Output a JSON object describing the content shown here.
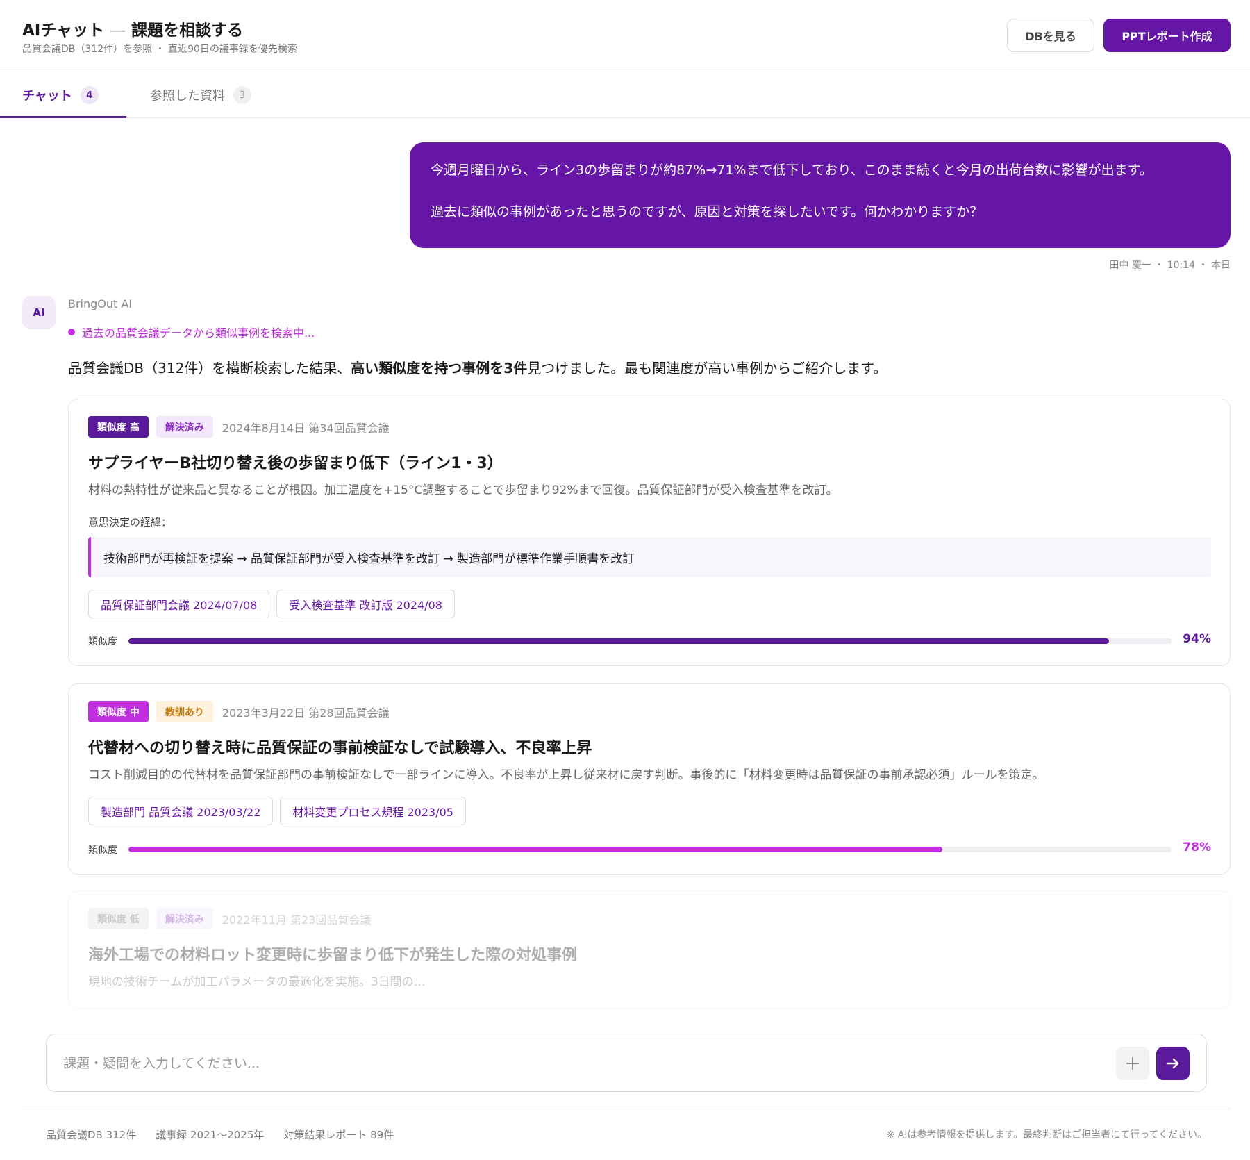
{
  "header": {
    "title": "AIチャット",
    "title_sep": "—",
    "title_sub": "課題を相談する",
    "subtitle": "品質会議DB（312件）を参照 ・ 直近90日の議事録を優先検索",
    "btn_db": "DBを見る",
    "btn_ppt": "PPTレポート作成"
  },
  "tabs": [
    {
      "label": "チャット",
      "count": "4",
      "active": true
    },
    {
      "label": "参照した資料",
      "count": "3",
      "active": false
    }
  ],
  "user_message": {
    "line1": "今週月曜日から、ライン3の歩留まりが約87%→71%まで低下しており、このまま続くと今月の出荷台数に影響が出ます。",
    "line2": "過去に類似の事例があったと思うのですが、原因と対策を探したいです。何かわかりますか？",
    "meta": "田中 慶一 ・ 10:14 ・ 本日"
  },
  "ai": {
    "avatar": "AI",
    "name": "BringOut AI",
    "status": "過去の品質会議データから類似事例を検索中...",
    "intro_pre": "品質会議DB（312件）を横断検索した結果、",
    "intro_bold": "高い類似度を持つ事例を3件",
    "intro_post": "見つけました。最も関連度が高い事例からご紹介します。"
  },
  "cases": [
    {
      "similarity_badge": "類似度 高",
      "status_badge": "解決済み",
      "date": "2024年8月14日 第34回品質会議",
      "title": "サプライヤーB社切り替え後の歩留まり低下（ライン1・3）",
      "desc": "材料の熱特性が従来品と異なることが根因。加工温度を+15°C調整することで歩留まり92%まで回復。品質保証部門が受入検査基準を改訂。",
      "decision_label": "意思決定の経緯：",
      "decision": "技術部門が再検証を提案 → 品質保証部門が受入検査基準を改訂 → 製造部門が標準作業手順書を改訂",
      "chips": [
        "品質保証部門会議 2024/07/08",
        "受入検査基準 改訂版 2024/08"
      ],
      "sim_label": "類似度",
      "sim_value": 94,
      "sim_text": "94%"
    },
    {
      "similarity_badge": "類似度 中",
      "status_badge": "教訓あり",
      "date": "2023年3月22日 第28回品質会議",
      "title": "代替材への切り替え時に品質保証の事前検証なしで試験導入、不良率上昇",
      "desc": "コスト削減目的の代替材を品質保証部門の事前検証なしで一部ラインに導入。不良率が上昇し従来材に戻す判断。事後的に「材料変更時は品質保証の事前承認必須」ルールを策定。",
      "chips": [
        "製造部門 品質会議 2023/03/22",
        "材料変更プロセス規程 2023/05"
      ],
      "sim_label": "類似度",
      "sim_value": 78,
      "sim_text": "78%"
    },
    {
      "similarity_badge": "類似度 低",
      "status_badge": "解決済み",
      "date": "2022年11月 第23回品質会議",
      "title": "海外工場での材料ロット変更時に歩留まり低下が発生した際の対処事例",
      "desc": "現地の技術チームが加工パラメータの最適化を実施。3日間の…"
    }
  ],
  "input": {
    "placeholder": "課題・疑問を入力してください..."
  },
  "footer": {
    "stat1": "品質会議DB 312件",
    "stat2": "議事録 2021〜2025年",
    "stat3": "対策結果レポート 89件",
    "note": "※ AIは参考情報を提供します。最終判断はご担当者にて行ってください。"
  },
  "colors": {
    "primary": "#6516a6",
    "accent": "#c02ee0",
    "lesson": "#c47a10"
  }
}
